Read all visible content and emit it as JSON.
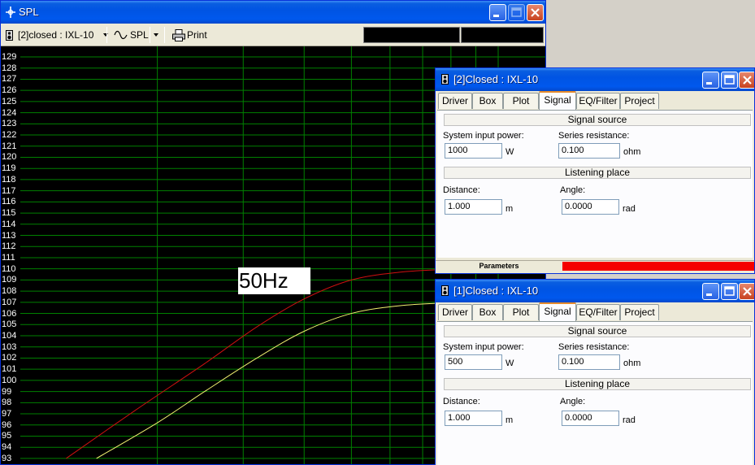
{
  "main": {
    "title": "SPL",
    "toolbar": {
      "project_select": "[2]closed : IXL-10",
      "view_select": "SPL",
      "print_label": "Print"
    },
    "plot": {
      "y_ticks": [
        "129",
        "128",
        "127",
        "126",
        "125",
        "124",
        "123",
        "122",
        "121",
        "120",
        "119",
        "118",
        "117",
        "116",
        "115",
        "114",
        "113",
        "112",
        "111",
        "110",
        "109",
        "108",
        "107",
        "106",
        "105",
        "104",
        "103",
        "102",
        "101",
        "100",
        "99",
        "98",
        "97",
        "96",
        "95",
        "94",
        "93"
      ],
      "marker_label": "50Hz"
    },
    "chart_data": {
      "type": "line",
      "ylim": [
        92.6,
        129.9
      ],
      "x_scale": "log",
      "grid": true,
      "series": [
        {
          "color": "#d01010",
          "x": [
            13,
            18,
            25,
            32,
            40,
            50,
            63,
            80,
            100,
            140,
            200
          ],
          "y": [
            93,
            97.3,
            101.5,
            104.8,
            107.3,
            109.0,
            109.7,
            109.95,
            110.0,
            110.05,
            110.05
          ]
        },
        {
          "color": "#f0f070",
          "x": [
            15,
            20,
            25,
            32,
            40,
            50,
            63,
            80,
            100,
            140,
            200
          ],
          "y": [
            93,
            96.2,
            99.0,
            102.0,
            104.4,
            106.0,
            106.7,
            106.95,
            107.0,
            107.05,
            107.05
          ]
        }
      ]
    }
  },
  "dialogs": [
    {
      "title": "[2]Closed : IXL-10",
      "tabs": [
        "Driver",
        "Box",
        "Plot",
        "Signal",
        "EQ/Filter",
        "Project"
      ],
      "active_tab": "Signal",
      "signal_source_heading": "Signal source",
      "power_label": "System input power:",
      "power_value": "1000",
      "power_unit": "W",
      "resistance_label": "Series resistance:",
      "resistance_value": "0.100",
      "resistance_unit": "ohm",
      "listening_heading": "Listening place",
      "distance_label": "Distance:",
      "distance_value": "1.000",
      "distance_unit": "m",
      "angle_label": "Angle:",
      "angle_value": "0.0000",
      "angle_unit": "rad",
      "status_label": "Parameters",
      "status_color": "#f50000"
    },
    {
      "title": "[1]Closed : IXL-10",
      "tabs": [
        "Driver",
        "Box",
        "Plot",
        "Signal",
        "EQ/Filter",
        "Project"
      ],
      "active_tab": "Signal",
      "signal_source_heading": "Signal source",
      "power_label": "System input power:",
      "power_value": "500",
      "power_unit": "W",
      "resistance_label": "Series resistance:",
      "resistance_value": "0.100",
      "resistance_unit": "ohm",
      "listening_heading": "Listening place",
      "distance_label": "Distance:",
      "distance_value": "1.000",
      "distance_unit": "m",
      "angle_label": "Angle:",
      "angle_value": "0.0000",
      "angle_unit": "rad"
    }
  ]
}
